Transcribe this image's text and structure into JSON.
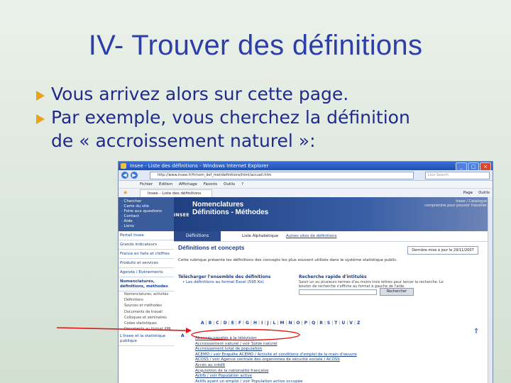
{
  "slide": {
    "title": "IV- Trouver des définitions",
    "bullets": [
      "Vous arrivez alors sur cette page.",
      "Par exemple, vous cherchez la définition",
      "de « accroissement naturel »:"
    ]
  },
  "browser": {
    "title": "Insee - Liste des définitions - Windows Internet Explorer",
    "url": "http://www.insee.fr/fr/nom_def_met/definitions/html/accueil.htm",
    "search_placeholder": "Live Search",
    "menu": [
      "Fichier",
      "Edition",
      "Affichage",
      "Favoris",
      "Outils",
      "?"
    ],
    "tab_label": "Insee - Liste des définitions",
    "tab_tools": [
      "Page",
      "Outils"
    ]
  },
  "site": {
    "quick_links": [
      "· Chercher",
      "· Carte du site",
      "· Foire aux questions",
      "· Contact",
      "· Aide",
      "· Liens"
    ],
    "nav": [
      "Portail Insee",
      "Grands indicateurs",
      "France en faits et chiffres",
      "Produits et services",
      "Agenda / Evènements",
      "Nomenclatures, définitions, méthodes"
    ],
    "subnav": [
      "Nomenclatures, activités",
      "Définitions",
      "Sources et méthodes",
      "Documents de travail",
      "Colloques et séminaires",
      "Codes statistiques",
      "Documents au format XML"
    ],
    "nav_after": [
      "L'Insee et la statistique publique"
    ],
    "logo": "INSEE",
    "header_title_1": "Nomenclatures",
    "header_title_2": "Définitions - Méthodes",
    "catalogue": "Insee / Catalogue",
    "catalogue_sub": "comprendre pour pouvoir travailler",
    "tabs": {
      "definitions": "Définitions",
      "liste": "Liste Alphabétique",
      "autres": "Autres sites de définitions"
    },
    "section_title": "Définitions et concepts",
    "updated": "Dernière mise à jour le 29/11/2007",
    "intro": "Cette rubrique présente les définitions des concepts les plus souvent utilisés dans le système statistique public.",
    "download_title": "Télécharger l'ensemble des définitions",
    "download_item": "• Les définitions au format Excel (595 Ko)",
    "rapid_title": "Recherche rapide d'intitulés",
    "rapid_text": "Saisir un ou plusieurs termes d'au moins trois lettres pour lancer la recherche. Le bouton de recherche s'affiche au format à gauche de l'aide.",
    "rapid_button": "Rechercher",
    "alphabet": [
      "A",
      "B",
      "C",
      "D",
      "E",
      "F",
      "G",
      "H",
      "I",
      "J",
      "L",
      "M",
      "N",
      "O",
      "P",
      "Q",
      "R",
      "S",
      "T",
      "U",
      "V",
      "Z"
    ],
    "section_letter": "A",
    "results": [
      "Abonnés couplés à la télévision",
      "Accroissement naturel / voir Solde naturel",
      "Accroissement total de population",
      "ACEMO / voir Enquête ACEMO / Activité et conditions d'emploi de la main-d'oeuvre",
      "ACOSS / voir Agence centrale des organismes de sécurité sociale / ACOSS",
      "Accès au crédit",
      "Acquisition de la nationalité française",
      "Actifs / voir Population active",
      "Actifs ayant un emploi / voir Population active occupée"
    ]
  },
  "annotation": {
    "arrow_color": "#e01818"
  }
}
